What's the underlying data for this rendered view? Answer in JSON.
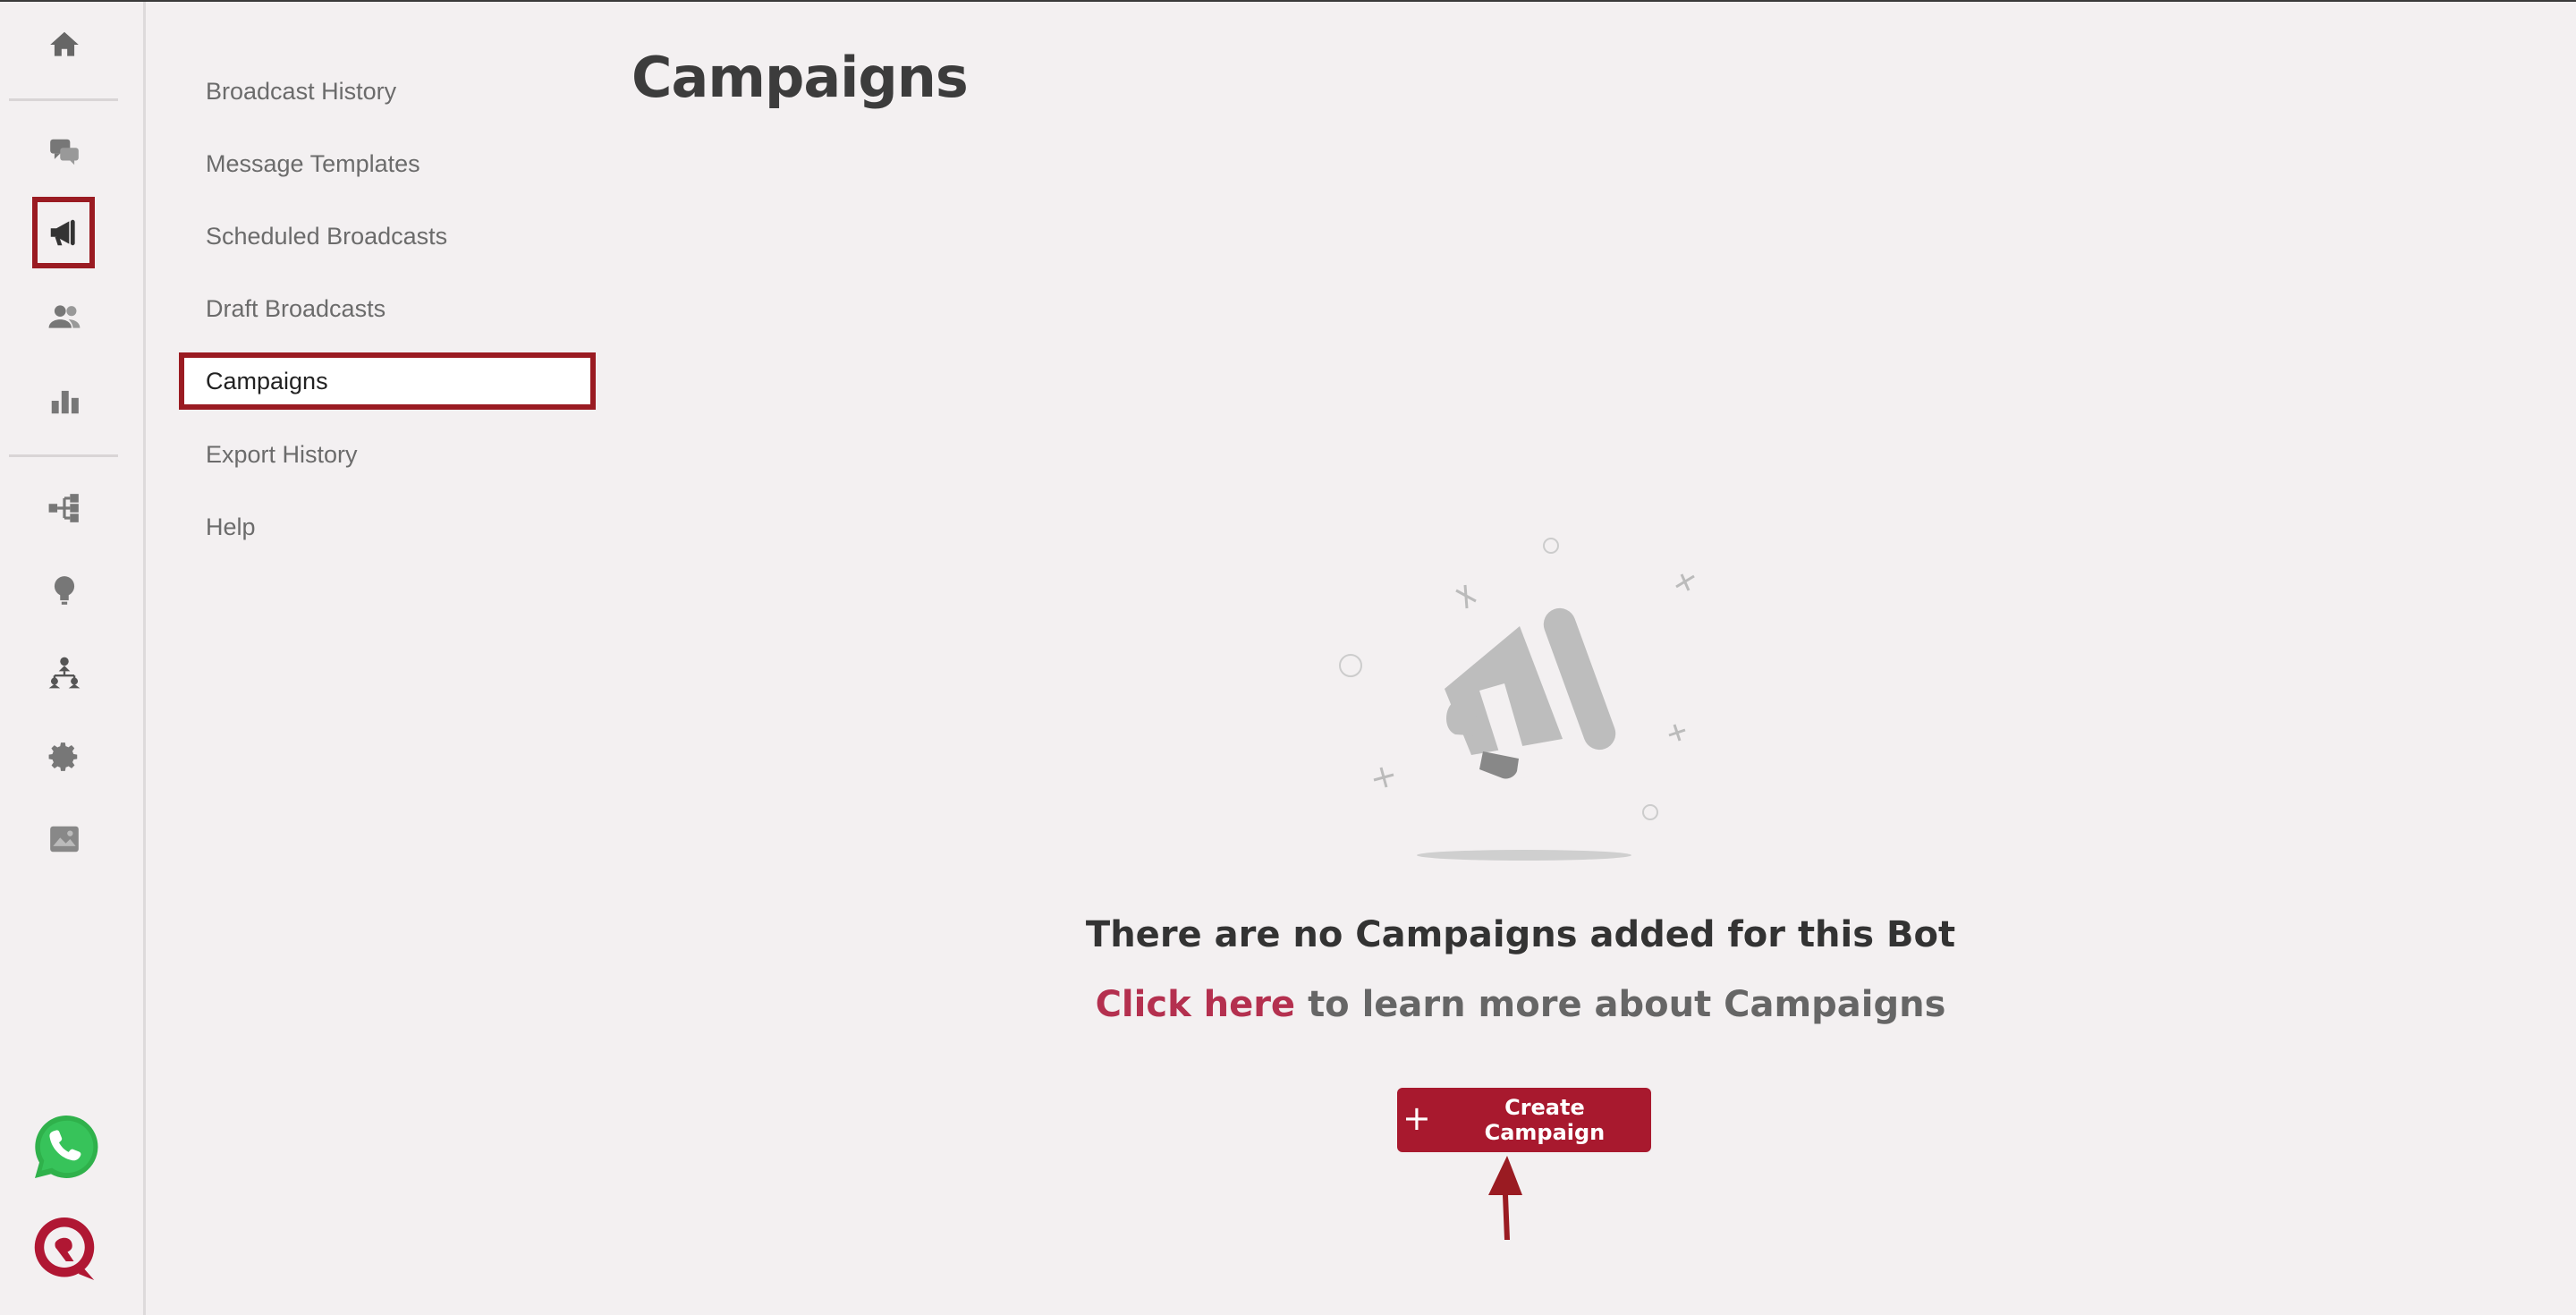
{
  "rail": {
    "icons": [
      "home-icon",
      "chat-icon",
      "megaphone-icon",
      "users-icon",
      "bar-chart-icon",
      "flow-icon",
      "lightbulb-icon",
      "org-chart-icon",
      "gear-icon",
      "image-icon",
      "whatsapp-icon",
      "app-logo-icon"
    ],
    "accent_color": "#9a1b22"
  },
  "subnav": {
    "items": [
      {
        "label": "Broadcast History"
      },
      {
        "label": "Message Templates"
      },
      {
        "label": "Scheduled Broadcasts"
      },
      {
        "label": "Draft Broadcasts"
      },
      {
        "label": "Campaigns"
      },
      {
        "label": "Export History"
      },
      {
        "label": "Help"
      }
    ],
    "active": "Campaigns"
  },
  "page": {
    "title": "Campaigns"
  },
  "empty_state": {
    "title": "There are no Campaigns added for this Bot",
    "link_text": "Click here",
    "link_suffix": "to learn more about Campaigns",
    "illustration_icon": "megaphone-illustration-icon"
  },
  "actions": {
    "create_label": "Create Campaign",
    "create_color": "#a8192e"
  }
}
